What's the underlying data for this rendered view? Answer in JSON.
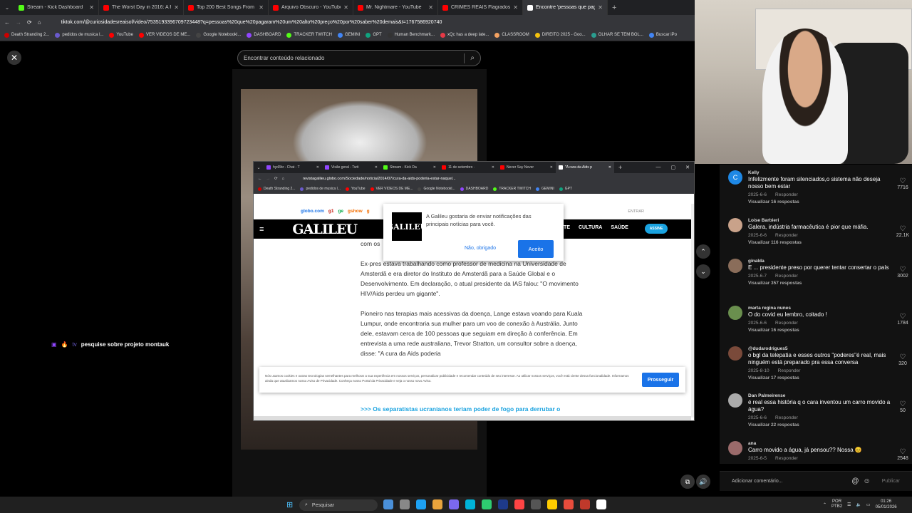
{
  "outer_tabs": [
    {
      "title": "Stream - Kick Dashboard",
      "color": "#53fc18",
      "active": false
    },
    {
      "title": "The Worst Day in 2016: A Playli",
      "color": "#ff0000",
      "active": false
    },
    {
      "title": "Top 200 Best Songs From 2010",
      "color": "#ff0000",
      "active": false
    },
    {
      "title": "Arquivo Obscuro - YouTube",
      "color": "#ff0000",
      "active": false
    },
    {
      "title": "Mr. Nightmare - YouTube",
      "color": "#ff0000",
      "active": false
    },
    {
      "title": "CRIMES REAIS Flagrados Pelo C",
      "color": "#ff0000",
      "active": false
    },
    {
      "title": "Encontre 'pessoas que pagaram",
      "color": "#ffffff",
      "active": true
    }
  ],
  "outer_url": "tiktok.com/@curiosidadesreaisof/video/7535193396709723448?q=pessoas%20que%20pagaram%20um%20alto%20preço%20por%20saber%20demais&t=1767586920740",
  "outer_bookmarks": [
    "Death Stranding 2...",
    "pedidos de musica l...",
    "YouTube",
    "VER VIDEOS DE ME...",
    "Google Notebookl...",
    "DASHBOARD",
    "TRACKER TWITCH",
    "GEMINI",
    "GPT",
    "Human Benchmark...",
    "xQc has a deep late...",
    "CLASSROOM",
    "DIREITO 2025 - Goo...",
    "OLHAR SE TEM BOL...",
    "Buscar  iPo"
  ],
  "tiktok": {
    "search_placeholder": "Encontrar conteúdo relacionado",
    "search_icon": "search-icon"
  },
  "chat_message": {
    "user": "tv",
    "text": "pesquise sobre projeto montauk"
  },
  "inner": {
    "tabs": [
      {
        "title": "hyd3br - Chat - T",
        "color": "#9146ff"
      },
      {
        "title": "Visão geral - Twit",
        "color": "#9146ff"
      },
      {
        "title": "Stream - Kick Da",
        "color": "#53fc18"
      },
      {
        "title": "11 de setembro ·",
        "color": "#ff0000"
      },
      {
        "title": "Never Say Never",
        "color": "#ff0000"
      },
      {
        "title": "\"A cura da Aids p",
        "color": "#ffffff",
        "active": true
      }
    ],
    "url": "revistagalileu.globo.com/Sociedade/noticia/2014/07/cura-da-aids-poderia-estar-naquel...",
    "bookmarks": [
      "Death Stranding 2...",
      "pedidos de musica l...",
      "YouTube",
      "VER VIDEOS DE ME...",
      "Google Notebookl...",
      "DASHBOARD",
      "TRACKER TWITCH",
      "GEMINI",
      "GPT"
    ],
    "globo_links": [
      "globo.com",
      "g1",
      "ge",
      "gshow",
      "g"
    ],
    "entrar": "ENTRAR",
    "logo": "GALILEU",
    "nav": [
      "NTE",
      "CULTURA",
      "SAÚDE"
    ],
    "assine": "ASSINE",
    "article": [
      "com os",
      "Ex-pres                                                                                    estava trabalhando como professor de medicina na Universidade de Amsterdã e era diretor do Instituto de Amsterdã para a Saúde Global e o Desenvolvimento. Em declaração, o atual presidente da IAS falou: \"O movimento HIV/Aids perdeu um gigante\".",
      "Pioneiro nas terapias mais acessivas da doença, Lange estava voando para Kuala Lumpur, onde encontraria sua mulher para um voo de conexão à Austrália. Junto dele, estavam cerca de 100 pessoas que seguiam em direção à conferência. Em entrevista a uma rede australiana, Trevor Stratton, um consultor sobre a doença, disse: \"A cura da Aids poderia"
    ],
    "related_link": ">>> Os separatistas ucranianos teriam poder de fogo para derrubar o",
    "notification": {
      "logo": "GALILEU",
      "message": "A Galileu gostaria de enviar notificações das principais notícias para você.",
      "decline": "Não, obrigado",
      "accept": "Aceito"
    },
    "cookie": {
      "text": "Nós usamos cookies e outras tecnologias semelhantes para melhorar a sua experiência em nossos serviços, personalizar publicidade e recomendar conteúdo de seu interesse. Ao utilizar nossos serviços, você está ciente dessa funcionalidade. Informamos ainda que atualizamos nosso Aviso de Privacidade. Conheça nosso Portal da Privacidade e veja o nosso novo Aviso.",
      "button": "Prosseguir"
    }
  },
  "comments": [
    {
      "name": "Kelly",
      "text": "Infelizmente foram silenciados,o sistema não deseja nosso bem estar",
      "date": "2025-6-6",
      "reply": "Responder",
      "view": "Visualizar 16 respostas",
      "likes": "7716",
      "avatar_color": "#1e88e5",
      "initial": "C"
    },
    {
      "name": "Loise Barbieri",
      "text": "Galera, indústria farmacêutica é pior que máfia.",
      "date": "2025-6-6",
      "reply": "Responder",
      "view": "Visualizar 116 respostas",
      "likes": "22.1K",
      "avatar_color": "#c9a28a",
      "initial": ""
    },
    {
      "name": "ginalda",
      "text": "E          ...    presidente preso por querer tentar consertar o país",
      "date": "2025-6-7",
      "reply": "Responder",
      "view": "Visualizar 357 respostas",
      "likes": "3002",
      "avatar_color": "#8a6d5a",
      "initial": ""
    },
    {
      "name": "marta regina nunes",
      "text": "O do covid eu lembro, coitado !",
      "date": "2025-6-6",
      "reply": "Responder",
      "view": "Visualizar 16 respostas",
      "likes": "1784",
      "avatar_color": "#6a8f4e",
      "initial": ""
    },
    {
      "name": "@dudarodrigues5",
      "text": "o bgl da telepatia e esses outros \"poderes\"é real, mais ninguém está preparado pra essa conversa",
      "date": "2025-8-10",
      "reply": "Responder",
      "view": "Visualizar 17 respostas",
      "likes": "320",
      "avatar_color": "#7a4a3a",
      "initial": ""
    },
    {
      "name": "Dan Palmeirense",
      "text": "é real essa história q o cara inventou um carro movido a água?",
      "date": "2025-6-6",
      "reply": "Responder",
      "view": "Visualizar 22 respostas",
      "likes": "50",
      "avatar_color": "#aaaaaa",
      "initial": ""
    },
    {
      "name": "ana",
      "text": "Carro movido a água, já pensou?? Nossa 😊",
      "date": "2025-6-5",
      "reply": "Responder",
      "view": "",
      "likes": "2548",
      "avatar_color": "#9a6a6a",
      "initial": ""
    }
  ],
  "add_comment": {
    "placeholder": "Adicionar comentário...",
    "publish": "Publicar"
  },
  "taskbar": {
    "search": "Pesquisar",
    "lang": "POR\nPTB2",
    "time": "01:26",
    "date": "05/01/2026",
    "icons": [
      "#4a90d9",
      "#888",
      "#1da1f2",
      "#e8a33c",
      "#7b68ee",
      "#00b4d8",
      "#2ecc71",
      "#1e3a8a",
      "#ff4444",
      "#555",
      "#ffcc00",
      "#e74c3c",
      "#c0392b",
      "#ffffff"
    ]
  }
}
